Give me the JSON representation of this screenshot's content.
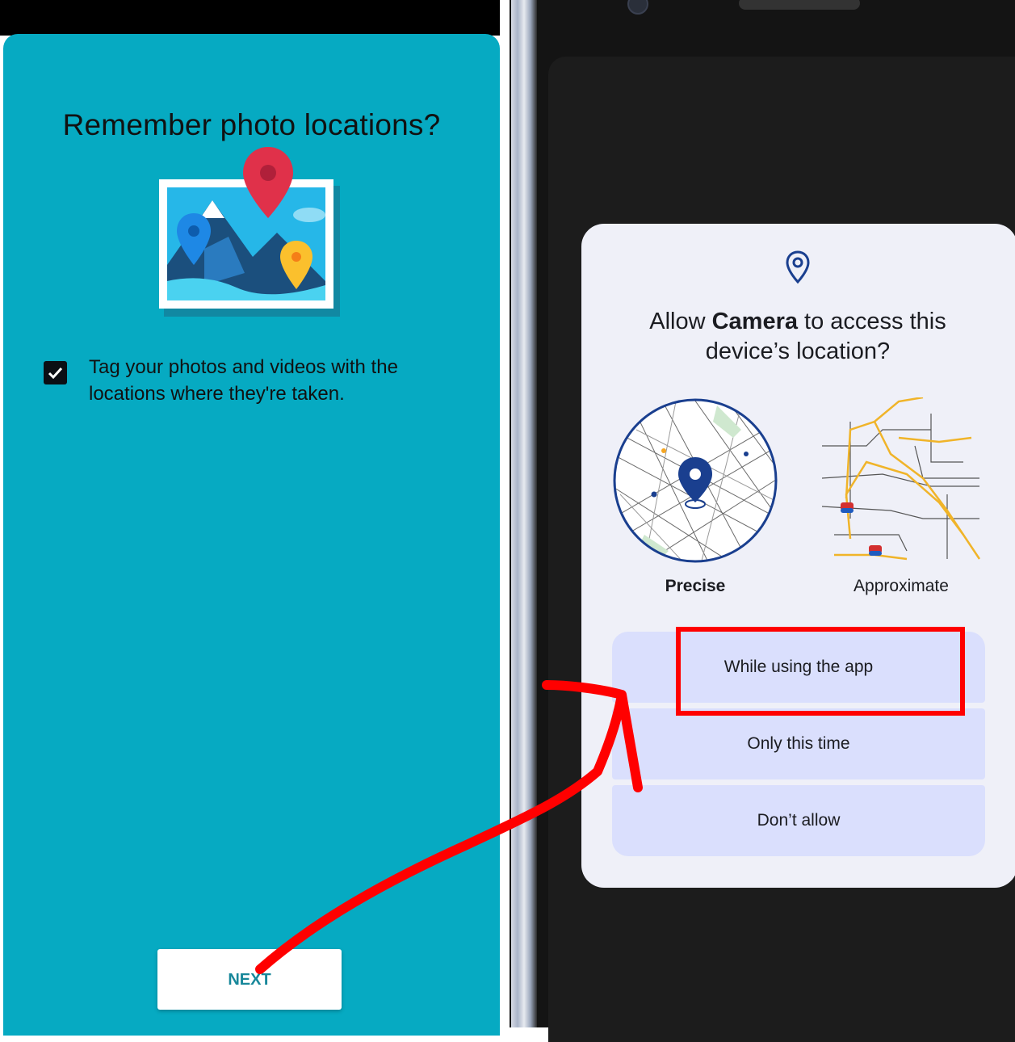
{
  "left": {
    "title": "Remember photo locations?",
    "tag_text": "Tag your photos and videos with the locations where they're taken.",
    "checkbox_checked": true,
    "next_label": "NEXT",
    "background_color": "#06aac2"
  },
  "dialog": {
    "title_pre": "Allow ",
    "title_app": "Camera",
    "title_post": " to access this device’s location?",
    "precise_label": "Precise",
    "approximate_label": "Approximate",
    "buttons": {
      "while_using": "While using the app",
      "only_this_time": "Only this time",
      "dont_allow": "Don’t allow"
    },
    "accent_color": "#1a3f8f",
    "button_color": "#dadffd"
  },
  "annotation": {
    "highlight_color": "#ff0000"
  }
}
